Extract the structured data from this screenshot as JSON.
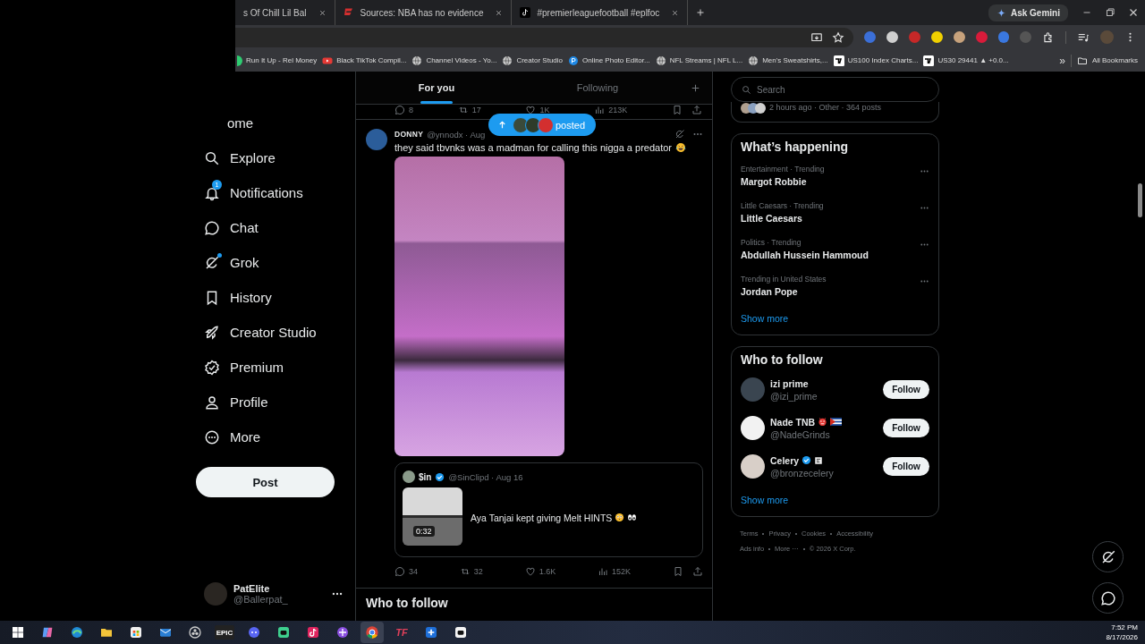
{
  "browser": {
    "tabs": [
      {
        "title": "s Of Chill Lil Bal",
        "kind": "cut",
        "selected": false
      },
      {
        "title": "Sources: NBA has no evidence",
        "kind": "news",
        "selected": false
      },
      {
        "title": "#premierleaguefootball #eplfoc",
        "kind": "tiktok",
        "selected": false
      }
    ],
    "ask_gemini": "Ask Gemini",
    "bookmarks": [
      {
        "title": "Run It Up - Rel Money",
        "kind": "green"
      },
      {
        "title": "Black TikTok Compil...",
        "kind": "youtube"
      },
      {
        "title": "Channel Videos - Yo...",
        "kind": "globe"
      },
      {
        "title": "Creator Studio",
        "kind": "globe"
      },
      {
        "title": "Online Photo Editor...",
        "kind": "editor"
      },
      {
        "title": "NFL Streams | NFL L...",
        "kind": "globe"
      },
      {
        "title": "Men's Sweatshirts,...",
        "kind": "globe"
      },
      {
        "title": "US100 Index Charts...",
        "kind": "charts"
      },
      {
        "title": "US30 29441 ▲ +0.0...",
        "kind": "charts"
      }
    ],
    "bookmarks_more": "»",
    "all_bookmarks": "All Bookmarks"
  },
  "nav": {
    "items": [
      {
        "label": "ome",
        "kind": "home",
        "unread": false
      },
      {
        "label": "Explore",
        "kind": "explore",
        "unread": false
      },
      {
        "label": "Notifications",
        "kind": "notifications",
        "badge": "1",
        "unread": false
      },
      {
        "label": "Chat",
        "kind": "chat",
        "unread": false
      },
      {
        "label": "Grok",
        "kind": "grok",
        "unread": true
      },
      {
        "label": "History",
        "kind": "bookmarks",
        "unread": false
      },
      {
        "label": "Creator Studio",
        "kind": "creator",
        "unread": false
      },
      {
        "label": "Premium",
        "kind": "premium",
        "unread": false
      },
      {
        "label": "Profile",
        "kind": "profile",
        "unread": false
      },
      {
        "label": "More",
        "kind": "more",
        "unread": false
      }
    ],
    "post_button": "Post",
    "account": {
      "name": "PatElite",
      "handle": "@Ballerpat_"
    }
  },
  "feed": {
    "tabs": [
      {
        "label": "For you",
        "selected": true
      },
      {
        "label": "Following",
        "selected": false
      }
    ],
    "previous_post_stats": {
      "replies": "8",
      "reposts": "17",
      "likes": "1K",
      "views": "213K"
    },
    "new_posts_pill": {
      "label": "posted"
    },
    "post": {
      "name": "DONNY",
      "verified": false,
      "handle": "@ynnodx · Aug",
      "text": "they said tbvnks was a madman for calling this nigga a predator",
      "quote": {
        "name": "$in",
        "verified": true,
        "handle": "@SinClipd · Aug 16",
        "text": "Aya Tanjai kept giving Melt HINTS",
        "duration": "0:32"
      },
      "stats": {
        "replies": "34",
        "reposts": "32",
        "likes": "1.6K",
        "views": "152K"
      }
    },
    "who_to_follow_heading": "Who to follow"
  },
  "sidebar": {
    "search": {
      "placeholder": "Search"
    },
    "previous_card": {
      "meta": "2 hours ago · Other · 364 posts"
    },
    "trending": {
      "title": "What’s happening",
      "items": [
        {
          "context": "Entertainment · Trending",
          "name": "Margot Robbie"
        },
        {
          "context": "Little Caesars · Trending",
          "name": "Little Caesars"
        },
        {
          "context": "Politics · Trending",
          "name": "Abdullah Hussein Hammoud"
        },
        {
          "context": "Trending in United States",
          "name": "Jordan Pope"
        }
      ],
      "show_more": "Show more"
    },
    "who_to_follow": {
      "title": "Who to follow",
      "accounts": [
        {
          "name": "izi prime",
          "handle": "@izi_prime",
          "verified": false,
          "button": "Follow"
        },
        {
          "name": "Nade TNB",
          "handle": "@NadeGrinds",
          "verified": false,
          "button": "Follow"
        },
        {
          "name": "Celery",
          "handle": "@bronzecelery",
          "verified": true,
          "button": "Follow"
        }
      ],
      "show_more": "Show more"
    },
    "footer": [
      [
        "Terms",
        "Privacy",
        "Cookies",
        "Accessibility"
      ],
      [
        "Ads info",
        "More ···",
        "© 2026 X Corp."
      ]
    ]
  },
  "taskbar": {
    "apps": [
      {
        "kind": "windows",
        "selected": false
      },
      {
        "kind": "copilot",
        "selected": false
      },
      {
        "kind": "edge",
        "selected": false
      },
      {
        "kind": "explorer",
        "selected": false
      },
      {
        "kind": "store",
        "selected": false
      },
      {
        "kind": "mail",
        "selected": false
      },
      {
        "kind": "obs",
        "selected": false
      },
      {
        "kind": "epic",
        "label": "EPIC",
        "selected": false
      },
      {
        "kind": "discord",
        "selected": false
      },
      {
        "kind": "gamepad",
        "selected": false
      },
      {
        "kind": "tiktok",
        "selected": false
      },
      {
        "kind": "purple",
        "selected": false
      },
      {
        "kind": "chrome",
        "selected": true
      },
      {
        "kind": "tf",
        "label": "TF",
        "selected": false
      },
      {
        "kind": "plus",
        "selected": false
      },
      {
        "kind": "gamepad2",
        "selected": false
      }
    ],
    "time": "7:52 PM",
    "date": "8/17/2026"
  }
}
